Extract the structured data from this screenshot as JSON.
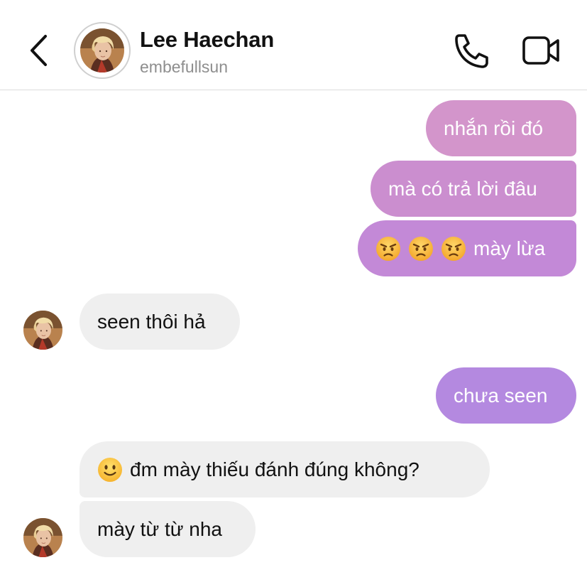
{
  "header": {
    "name": "Lee Haechan",
    "username": "embefullsun"
  },
  "icons": {
    "back": "chevron-left-icon",
    "call": "phone-icon",
    "video": "video-camera-icon",
    "avatar": "profile-photo"
  },
  "colors": {
    "outgoing_pink": "#d38fcb",
    "outgoing_purple": "#c285dc",
    "outgoing_violet": "#b487e0",
    "incoming": "#efefef"
  },
  "messages": [
    {
      "direction": "outgoing",
      "text": "nhắn rồi đó"
    },
    {
      "direction": "outgoing",
      "text": "mà có trả lời đâu"
    },
    {
      "direction": "outgoing",
      "emoji": [
        "angry-face",
        "angry-face",
        "angry-face"
      ],
      "text": "mày lừa"
    },
    {
      "direction": "incoming",
      "text": "seen thôi hả"
    },
    {
      "direction": "outgoing",
      "text": "chưa seen"
    },
    {
      "direction": "incoming",
      "emoji": [
        "slightly-smiling-face"
      ],
      "text": "đm mày thiếu đánh đúng không?"
    },
    {
      "direction": "incoming",
      "text": "mày từ từ nha"
    }
  ]
}
